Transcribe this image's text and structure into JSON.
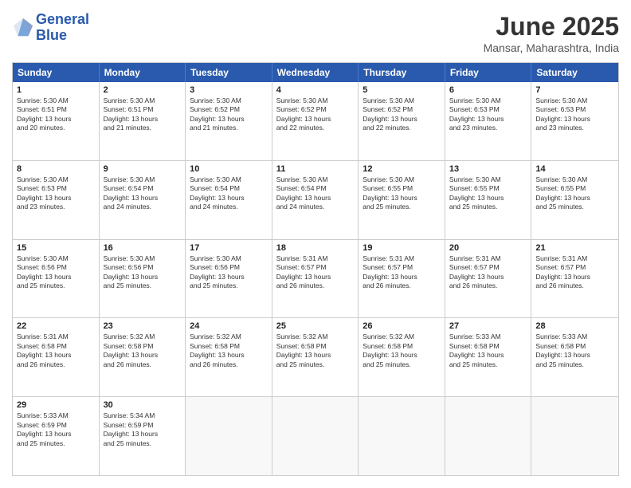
{
  "logo": {
    "line1": "General",
    "line2": "Blue"
  },
  "title": "June 2025",
  "subtitle": "Mansar, Maharashtra, India",
  "headers": [
    "Sunday",
    "Monday",
    "Tuesday",
    "Wednesday",
    "Thursday",
    "Friday",
    "Saturday"
  ],
  "rows": [
    [
      {
        "day": "",
        "info": ""
      },
      {
        "day": "2",
        "info": "Sunrise: 5:30 AM\nSunset: 6:51 PM\nDaylight: 13 hours\nand 21 minutes."
      },
      {
        "day": "3",
        "info": "Sunrise: 5:30 AM\nSunset: 6:52 PM\nDaylight: 13 hours\nand 21 minutes."
      },
      {
        "day": "4",
        "info": "Sunrise: 5:30 AM\nSunset: 6:52 PM\nDaylight: 13 hours\nand 22 minutes."
      },
      {
        "day": "5",
        "info": "Sunrise: 5:30 AM\nSunset: 6:52 PM\nDaylight: 13 hours\nand 22 minutes."
      },
      {
        "day": "6",
        "info": "Sunrise: 5:30 AM\nSunset: 6:53 PM\nDaylight: 13 hours\nand 23 minutes."
      },
      {
        "day": "7",
        "info": "Sunrise: 5:30 AM\nSunset: 6:53 PM\nDaylight: 13 hours\nand 23 minutes."
      }
    ],
    [
      {
        "day": "1",
        "info": "Sunrise: 5:30 AM\nSunset: 6:51 PM\nDaylight: 13 hours\nand 20 minutes."
      },
      {
        "day": "9",
        "info": "Sunrise: 5:30 AM\nSunset: 6:54 PM\nDaylight: 13 hours\nand 24 minutes."
      },
      {
        "day": "10",
        "info": "Sunrise: 5:30 AM\nSunset: 6:54 PM\nDaylight: 13 hours\nand 24 minutes."
      },
      {
        "day": "11",
        "info": "Sunrise: 5:30 AM\nSunset: 6:54 PM\nDaylight: 13 hours\nand 24 minutes."
      },
      {
        "day": "12",
        "info": "Sunrise: 5:30 AM\nSunset: 6:55 PM\nDaylight: 13 hours\nand 25 minutes."
      },
      {
        "day": "13",
        "info": "Sunrise: 5:30 AM\nSunset: 6:55 PM\nDaylight: 13 hours\nand 25 minutes."
      },
      {
        "day": "14",
        "info": "Sunrise: 5:30 AM\nSunset: 6:55 PM\nDaylight: 13 hours\nand 25 minutes."
      }
    ],
    [
      {
        "day": "8",
        "info": "Sunrise: 5:30 AM\nSunset: 6:53 PM\nDaylight: 13 hours\nand 23 minutes."
      },
      {
        "day": "16",
        "info": "Sunrise: 5:30 AM\nSunset: 6:56 PM\nDaylight: 13 hours\nand 25 minutes."
      },
      {
        "day": "17",
        "info": "Sunrise: 5:30 AM\nSunset: 6:56 PM\nDaylight: 13 hours\nand 25 minutes."
      },
      {
        "day": "18",
        "info": "Sunrise: 5:31 AM\nSunset: 6:57 PM\nDaylight: 13 hours\nand 26 minutes."
      },
      {
        "day": "19",
        "info": "Sunrise: 5:31 AM\nSunset: 6:57 PM\nDaylight: 13 hours\nand 26 minutes."
      },
      {
        "day": "20",
        "info": "Sunrise: 5:31 AM\nSunset: 6:57 PM\nDaylight: 13 hours\nand 26 minutes."
      },
      {
        "day": "21",
        "info": "Sunrise: 5:31 AM\nSunset: 6:57 PM\nDaylight: 13 hours\nand 26 minutes."
      }
    ],
    [
      {
        "day": "15",
        "info": "Sunrise: 5:30 AM\nSunset: 6:56 PM\nDaylight: 13 hours\nand 25 minutes."
      },
      {
        "day": "23",
        "info": "Sunrise: 5:32 AM\nSunset: 6:58 PM\nDaylight: 13 hours\nand 26 minutes."
      },
      {
        "day": "24",
        "info": "Sunrise: 5:32 AM\nSunset: 6:58 PM\nDaylight: 13 hours\nand 26 minutes."
      },
      {
        "day": "25",
        "info": "Sunrise: 5:32 AM\nSunset: 6:58 PM\nDaylight: 13 hours\nand 25 minutes."
      },
      {
        "day": "26",
        "info": "Sunrise: 5:32 AM\nSunset: 6:58 PM\nDaylight: 13 hours\nand 25 minutes."
      },
      {
        "day": "27",
        "info": "Sunrise: 5:33 AM\nSunset: 6:58 PM\nDaylight: 13 hours\nand 25 minutes."
      },
      {
        "day": "28",
        "info": "Sunrise: 5:33 AM\nSunset: 6:58 PM\nDaylight: 13 hours\nand 25 minutes."
      }
    ],
    [
      {
        "day": "22",
        "info": "Sunrise: 5:31 AM\nSunset: 6:58 PM\nDaylight: 13 hours\nand 26 minutes."
      },
      {
        "day": "30",
        "info": "Sunrise: 5:34 AM\nSunset: 6:59 PM\nDaylight: 13 hours\nand 25 minutes."
      },
      {
        "day": "",
        "info": ""
      },
      {
        "day": "",
        "info": ""
      },
      {
        "day": "",
        "info": ""
      },
      {
        "day": "",
        "info": ""
      },
      {
        "day": "",
        "info": ""
      }
    ],
    [
      {
        "day": "29",
        "info": "Sunrise: 5:33 AM\nSunset: 6:59 PM\nDaylight: 13 hours\nand 25 minutes."
      },
      {
        "day": "",
        "info": ""
      },
      {
        "day": "",
        "info": ""
      },
      {
        "day": "",
        "info": ""
      },
      {
        "day": "",
        "info": ""
      },
      {
        "day": "",
        "info": ""
      },
      {
        "day": "",
        "info": ""
      }
    ]
  ]
}
